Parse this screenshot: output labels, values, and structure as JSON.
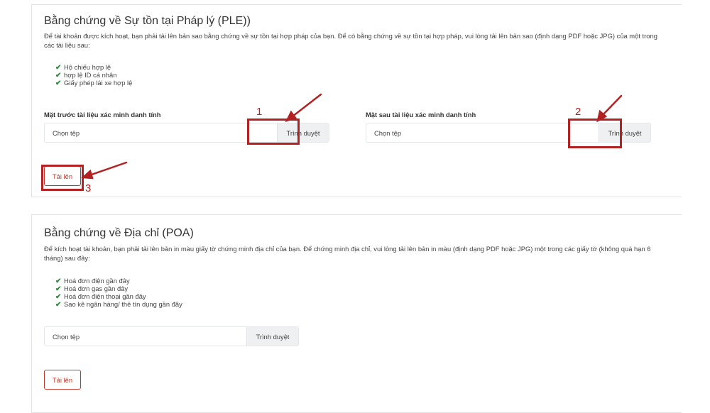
{
  "ple": {
    "title": "Bằng chứng về Sự tồn tại Pháp lý (PLE))",
    "desc": "Để tài khoản được kích hoạt, bạn phải tải lên bản sao bằng chứng về sự tồn tại hợp pháp của bạn. Để có bằng chứng về sự tồn tại hợp pháp, vui lòng tải lên bản sao (định dạng PDF hoặc JPG) của một trong các tài liệu sau:",
    "items": [
      "Hộ chiếu hợp lệ",
      "hợp lệ ID cá nhân",
      "Giấy phép lái xe hợp lệ"
    ],
    "front": {
      "label": "Mặt trước tài liệu xác minh danh tính",
      "value": "Chọn tệp",
      "browse": "Trình duyệt"
    },
    "back": {
      "label": "Mặt sau tài liệu xác minh danh tính",
      "value": "Chọn tệp",
      "browse": "Trình duyệt"
    },
    "upload": "Tải lên"
  },
  "poa": {
    "title": "Bằng chứng về Địa chỉ (POA)",
    "desc": "Để kích hoạt tài khoản, bạn phải tải lên bản in màu giấy tờ chứng minh địa chỉ của bạn. Để chứng minh địa chỉ, vui lòng tải lên bản in màu (định dạng PDF hoặc JPG) một trong các giấy tờ (không quá hạn 6 tháng) sau đây:",
    "items": [
      "Hoá đơn điện gần đây",
      "Hoá đơn gas gần đây",
      "Hoá đơn điện thoại gần đây",
      "Sao kê ngân hàng/ thẻ tín dụng gần đây"
    ],
    "file": {
      "value": "Chọn tệp",
      "browse": "Trình duyệt"
    },
    "upload": "Tải lên"
  },
  "annotations": {
    "m1": "1",
    "m2": "2",
    "m3": "3",
    "color": "#b22222"
  },
  "icons": {
    "check": "check-icon"
  }
}
